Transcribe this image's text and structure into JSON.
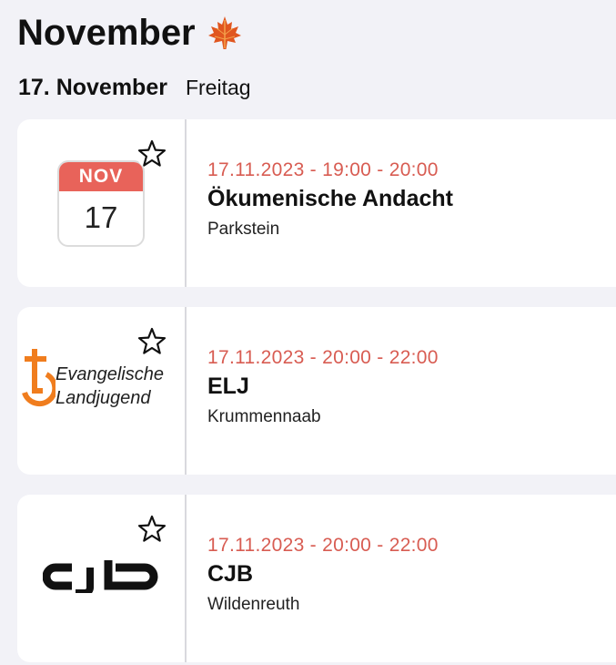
{
  "section": {
    "month_title": "November",
    "leaf_icon": "maple-leaf-icon"
  },
  "day": {
    "date": "17. November",
    "weekday": "Freitag"
  },
  "events": [
    {
      "time": "17.11.2023 - 19:00 - 20:00",
      "title": "Ökumenische Andacht",
      "location": "Parkstein",
      "image": {
        "type": "calendar-icon",
        "month": "NOV",
        "day": "17"
      },
      "favorite_icon": "star-outline-icon"
    },
    {
      "time": "17.11.2023 - 20:00 - 22:00",
      "title": "ELJ",
      "location": "Krummennaab",
      "image": {
        "type": "elj-logo",
        "line1": "Evangelische",
        "line2": "Landjugend"
      },
      "favorite_icon": "star-outline-icon"
    },
    {
      "time": "17.11.2023 - 20:00 - 22:00",
      "title": "CJB",
      "location": "Wildenreuth",
      "image": {
        "type": "cjb-logo",
        "text": "cjb"
      },
      "favorite_icon": "star-outline-icon"
    }
  ],
  "colors": {
    "accent_time": "#d85c52",
    "calendar_red": "#e8635a",
    "elj_orange": "#f07d1e",
    "background": "#f2f2f7",
    "card": "#ffffff"
  }
}
